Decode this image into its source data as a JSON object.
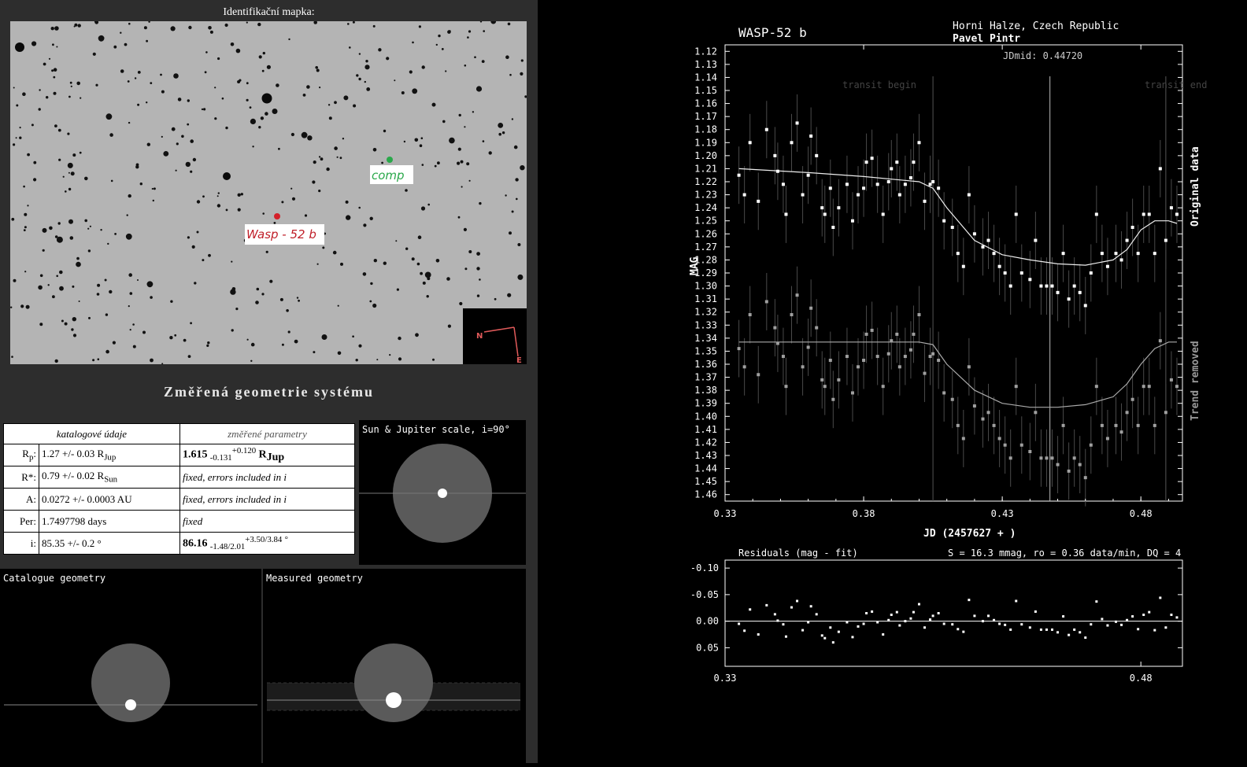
{
  "finder": {
    "title": "Identifikační mapka:",
    "target_label": "Wasp - 52 b",
    "comp_label": "comp",
    "compass_n": "N",
    "compass_e": "E"
  },
  "geometry": {
    "title": "Změřená geometrie systému",
    "col_catalog": "katalogové údaje",
    "col_measured": "změřené parametry",
    "rows": [
      {
        "key": "Rp",
        "key_sub": "p",
        "catalog": "1.27 +/- 0.03 R",
        "catalog_sub": "Jup",
        "measured": "1.615",
        "measured_low": "-0.131",
        "measured_high": "+0.120",
        "measured_unit": "R",
        "measured_unit_sub": "Jup"
      },
      {
        "key": "R*",
        "catalog": "0.79 +/- 0.02 R",
        "catalog_sub": "Sun",
        "measured_note": "fixed, errors included in i"
      },
      {
        "key": "A",
        "catalog": "0.0272 +/- 0.0003 AU",
        "measured_note": "fixed, errors included in i"
      },
      {
        "key": "Per",
        "catalog": "1.7497798 days",
        "measured_note": "fixed"
      },
      {
        "key": "i",
        "catalog": "85.35 +/- 0.2 °",
        "measured": "86.16",
        "measured_low": "-1.48",
        "measured_low2": "2.01",
        "measured_high": "+3.50",
        "measured_high2": "3.84",
        "measured_unit": "°"
      }
    ]
  },
  "panels": {
    "sun_jupiter": "Sun & Jupiter scale, i=90°",
    "catalogue": "Catalogue geometry",
    "measured": "Measured geometry"
  },
  "chart_data": {
    "type": "scatter",
    "title": "WASP-52 b",
    "location": "Horni Halze, Czech Republic",
    "observer": "Pavel Pintr",
    "jdmid_label": "JDmid: 0.44720",
    "transit_begin_label": "transit begin",
    "transit_end_label": "transit end",
    "xlabel": "JD (2457627 + )",
    "ylabel": "MAG",
    "right_label_top": "Original data",
    "right_label_bottom": "Trend removed",
    "xlim": [
      0.33,
      0.495
    ],
    "ylim": [
      1.115,
      1.465
    ],
    "x_ticks": [
      0.33,
      0.38,
      0.43,
      0.48
    ],
    "y_ticks": [
      1.12,
      1.13,
      1.14,
      1.15,
      1.16,
      1.17,
      1.18,
      1.19,
      1.2,
      1.21,
      1.22,
      1.23,
      1.24,
      1.25,
      1.26,
      1.27,
      1.28,
      1.29,
      1.3,
      1.31,
      1.32,
      1.33,
      1.34,
      1.35,
      1.36,
      1.37,
      1.38,
      1.39,
      1.4,
      1.41,
      1.42,
      1.43,
      1.44,
      1.45,
      1.46
    ],
    "transit_begin": 0.405,
    "transit_mid": 0.4472,
    "transit_end": 0.489,
    "series": [
      {
        "color": "#ffffff",
        "x": [
          0.335,
          0.337,
          0.339,
          0.342,
          0.345,
          0.348,
          0.349,
          0.351,
          0.352,
          0.354,
          0.356,
          0.358,
          0.36,
          0.361,
          0.363,
          0.365,
          0.366,
          0.368,
          0.369,
          0.371,
          0.374,
          0.376,
          0.378,
          0.38,
          0.381,
          0.383,
          0.385,
          0.387,
          0.389,
          0.39,
          0.392,
          0.393,
          0.395,
          0.397,
          0.398,
          0.4,
          0.402,
          0.404,
          0.405,
          0.407,
          0.409,
          0.412,
          0.414,
          0.416,
          0.418,
          0.42,
          0.423,
          0.425,
          0.427,
          0.429,
          0.431,
          0.433,
          0.435,
          0.437,
          0.44,
          0.442,
          0.444,
          0.446,
          0.448,
          0.45,
          0.452,
          0.454,
          0.456,
          0.458,
          0.46,
          0.462,
          0.464,
          0.466,
          0.468,
          0.471,
          0.473,
          0.475,
          0.477,
          0.479,
          0.481,
          0.483,
          0.485,
          0.487,
          0.489,
          0.491,
          0.493
        ],
        "y": [
          1.215,
          1.23,
          1.19,
          1.235,
          1.18,
          1.2,
          1.212,
          1.222,
          1.245,
          1.19,
          1.175,
          1.23,
          1.215,
          1.185,
          1.2,
          1.24,
          1.245,
          1.225,
          1.255,
          1.24,
          1.222,
          1.25,
          1.23,
          1.225,
          1.205,
          1.202,
          1.222,
          1.245,
          1.22,
          1.21,
          1.205,
          1.23,
          1.222,
          1.217,
          1.205,
          1.19,
          1.235,
          1.222,
          1.22,
          1.225,
          1.25,
          1.255,
          1.275,
          1.285,
          1.23,
          1.26,
          1.27,
          1.265,
          1.275,
          1.285,
          1.29,
          1.3,
          1.245,
          1.29,
          1.295,
          1.265,
          1.3,
          1.3,
          1.3,
          1.305,
          1.275,
          1.31,
          1.3,
          1.305,
          1.315,
          1.29,
          1.245,
          1.275,
          1.285,
          1.275,
          1.28,
          1.265,
          1.255,
          1.275,
          1.245,
          1.245,
          1.275,
          1.21,
          1.265,
          1.24,
          1.245
        ]
      },
      {
        "color": "#a0a0a0",
        "x": [
          0.335,
          0.337,
          0.339,
          0.342,
          0.345,
          0.348,
          0.349,
          0.351,
          0.352,
          0.354,
          0.356,
          0.358,
          0.36,
          0.361,
          0.363,
          0.365,
          0.366,
          0.368,
          0.369,
          0.371,
          0.374,
          0.376,
          0.378,
          0.38,
          0.381,
          0.383,
          0.385,
          0.387,
          0.389,
          0.39,
          0.392,
          0.393,
          0.395,
          0.397,
          0.398,
          0.4,
          0.402,
          0.404,
          0.405,
          0.407,
          0.409,
          0.412,
          0.414,
          0.416,
          0.418,
          0.42,
          0.423,
          0.425,
          0.427,
          0.429,
          0.431,
          0.433,
          0.435,
          0.437,
          0.44,
          0.442,
          0.444,
          0.446,
          0.448,
          0.45,
          0.452,
          0.454,
          0.456,
          0.458,
          0.46,
          0.462,
          0.464,
          0.466,
          0.468,
          0.471,
          0.473,
          0.475,
          0.477,
          0.479,
          0.481,
          0.483,
          0.485,
          0.487,
          0.489,
          0.491,
          0.493
        ],
        "y": [
          1.348,
          1.362,
          1.322,
          1.368,
          1.312,
          1.332,
          1.344,
          1.354,
          1.377,
          1.322,
          1.307,
          1.362,
          1.347,
          1.317,
          1.332,
          1.372,
          1.377,
          1.357,
          1.387,
          1.372,
          1.354,
          1.382,
          1.362,
          1.357,
          1.337,
          1.334,
          1.354,
          1.377,
          1.352,
          1.342,
          1.337,
          1.362,
          1.354,
          1.349,
          1.337,
          1.322,
          1.367,
          1.354,
          1.352,
          1.357,
          1.382,
          1.387,
          1.407,
          1.417,
          1.362,
          1.392,
          1.402,
          1.397,
          1.407,
          1.417,
          1.422,
          1.432,
          1.377,
          1.422,
          1.427,
          1.397,
          1.432,
          1.432,
          1.432,
          1.437,
          1.407,
          1.442,
          1.432,
          1.437,
          1.447,
          1.422,
          1.377,
          1.407,
          1.417,
          1.407,
          1.412,
          1.397,
          1.387,
          1.407,
          1.377,
          1.377,
          1.407,
          1.342,
          1.397,
          1.372,
          1.377
        ]
      }
    ],
    "fit_top": {
      "x": [
        0.335,
        0.36,
        0.38,
        0.4,
        0.405,
        0.41,
        0.42,
        0.43,
        0.44,
        0.45,
        0.46,
        0.47,
        0.475,
        0.48,
        0.485,
        0.49,
        0.493
      ],
      "y": [
        1.21,
        1.213,
        1.216,
        1.22,
        1.225,
        1.24,
        1.265,
        1.276,
        1.28,
        1.283,
        1.284,
        1.28,
        1.272,
        1.257,
        1.25,
        1.25,
        1.252
      ]
    },
    "fit_bottom": {
      "x": [
        0.335,
        0.36,
        0.38,
        0.4,
        0.405,
        0.41,
        0.42,
        0.43,
        0.44,
        0.45,
        0.46,
        0.47,
        0.475,
        0.48,
        0.485,
        0.49,
        0.493
      ],
      "y": [
        1.343,
        1.343,
        1.343,
        1.343,
        1.345,
        1.36,
        1.38,
        1.39,
        1.393,
        1.393,
        1.391,
        1.385,
        1.375,
        1.36,
        1.348,
        1.343,
        1.343
      ]
    },
    "residuals": {
      "title": "Residuals (mag - fit)",
      "stats": "S = 16.3 mmag, ro = 0.36 data/min, DQ = 4",
      "ylim": [
        -0.115,
        0.085
      ],
      "y_ticks": [
        "-0.10",
        "-0.05",
        "0.00",
        "0.05"
      ],
      "x_ticks": [
        0.33,
        0.48
      ],
      "x": [
        0.335,
        0.337,
        0.339,
        0.342,
        0.345,
        0.348,
        0.349,
        0.351,
        0.352,
        0.354,
        0.356,
        0.358,
        0.36,
        0.361,
        0.363,
        0.365,
        0.366,
        0.368,
        0.369,
        0.371,
        0.374,
        0.376,
        0.378,
        0.38,
        0.381,
        0.383,
        0.385,
        0.387,
        0.389,
        0.39,
        0.392,
        0.393,
        0.395,
        0.397,
        0.398,
        0.4,
        0.402,
        0.404,
        0.405,
        0.407,
        0.409,
        0.412,
        0.414,
        0.416,
        0.418,
        0.42,
        0.423,
        0.425,
        0.427,
        0.429,
        0.431,
        0.433,
        0.435,
        0.437,
        0.44,
        0.442,
        0.444,
        0.446,
        0.448,
        0.45,
        0.452,
        0.454,
        0.456,
        0.458,
        0.46,
        0.462,
        0.464,
        0.466,
        0.468,
        0.471,
        0.473,
        0.475,
        0.477,
        0.479,
        0.481,
        0.483,
        0.485,
        0.487,
        0.489,
        0.491,
        0.493
      ],
      "y": [
        0.005,
        0.018,
        -0.022,
        0.025,
        -0.03,
        -0.013,
        -0.001,
        0.006,
        0.029,
        -0.026,
        -0.038,
        0.017,
        0.002,
        -0.028,
        -0.013,
        0.027,
        0.032,
        0.012,
        0.04,
        0.02,
        0.002,
        0.03,
        0.01,
        0.005,
        -0.015,
        -0.018,
        0.002,
        0.025,
        -0.002,
        -0.012,
        -0.017,
        0.008,
        0.0,
        -0.005,
        -0.017,
        -0.032,
        0.012,
        -0.003,
        -0.01,
        -0.015,
        0.005,
        0.006,
        0.015,
        0.02,
        -0.04,
        -0.01,
        0.0,
        -0.01,
        -0.002,
        0.005,
        0.007,
        0.016,
        -0.038,
        0.006,
        0.012,
        -0.018,
        0.016,
        0.016,
        0.016,
        0.021,
        -0.009,
        0.026,
        0.016,
        0.021,
        0.031,
        0.006,
        -0.037,
        -0.004,
        0.008,
        0.001,
        0.007,
        -0.002,
        -0.009,
        0.015,
        -0.012,
        -0.017,
        0.017,
        -0.044,
        0.012,
        -0.012,
        -0.007
      ]
    }
  }
}
